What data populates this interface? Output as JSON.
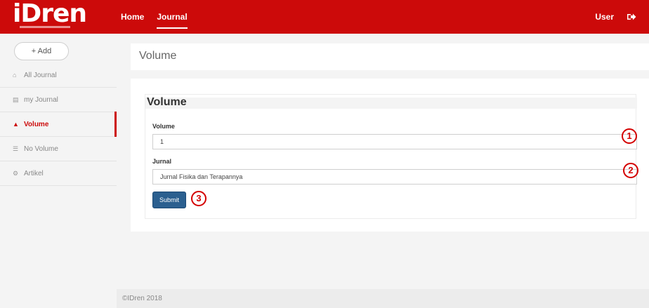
{
  "brand": {
    "logo_text": "iDren"
  },
  "topbar": {
    "nav": [
      {
        "label": "Home"
      },
      {
        "label": "Journal"
      }
    ],
    "user_label": "User"
  },
  "sidebar": {
    "add_label": "+ Add",
    "items": [
      {
        "label": "All Journal",
        "icon": "home-icon"
      },
      {
        "label": "my Journal",
        "icon": "book-icon"
      },
      {
        "label": "Volume",
        "icon": "user-icon"
      },
      {
        "label": "No Volume",
        "icon": "list-icon"
      },
      {
        "label": "Artikel",
        "icon": "gear-icon"
      }
    ]
  },
  "page": {
    "title": "Volume"
  },
  "form": {
    "title": "Volume",
    "volume_label": "Volume",
    "volume_value": "1",
    "jurnal_label": "Jurnal",
    "jurnal_value": "Jurnal Fisika dan Terapannya",
    "submit_label": "Submit"
  },
  "callouts": [
    "1",
    "2",
    "3"
  ],
  "footer": {
    "text": "©IDren 2018"
  },
  "colors": {
    "brand_red": "#cc0a0a",
    "submit_blue": "#2b5f8f",
    "callout_red": "#d40000"
  }
}
